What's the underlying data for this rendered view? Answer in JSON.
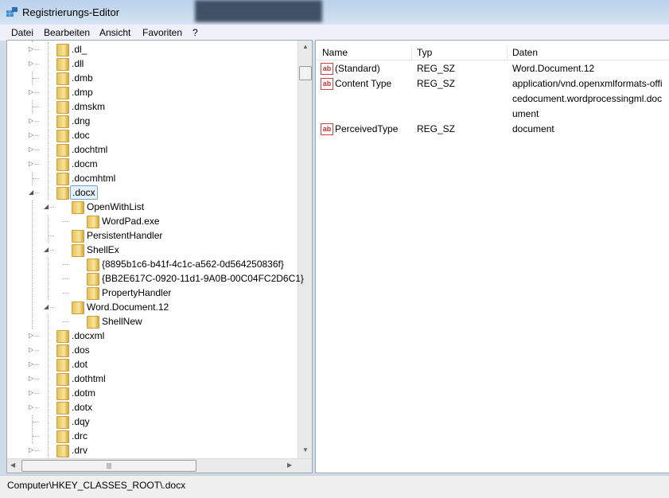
{
  "window": {
    "title": "Registrierungs-Editor"
  },
  "menu": [
    "Datei",
    "Bearbeiten",
    "Ansicht",
    "Favoriten",
    "?"
  ],
  "tree": [
    {
      "label": ".dl_",
      "level": 0,
      "expander": "collapsed"
    },
    {
      "label": ".dll",
      "level": 0,
      "expander": "collapsed"
    },
    {
      "label": ".dmb",
      "level": 0,
      "expander": "none"
    },
    {
      "label": ".dmp",
      "level": 0,
      "expander": "collapsed"
    },
    {
      "label": ".dmskm",
      "level": 0,
      "expander": "none"
    },
    {
      "label": ".dng",
      "level": 0,
      "expander": "collapsed"
    },
    {
      "label": ".doc",
      "level": 0,
      "expander": "collapsed"
    },
    {
      "label": ".dochtml",
      "level": 0,
      "expander": "collapsed"
    },
    {
      "label": ".docm",
      "level": 0,
      "expander": "collapsed"
    },
    {
      "label": ".docmhtml",
      "level": 0,
      "expander": "none"
    },
    {
      "label": ".docx",
      "level": 0,
      "expander": "expanded",
      "selected": true
    },
    {
      "label": "OpenWithList",
      "level": 1,
      "expander": "expanded"
    },
    {
      "label": "WordPad.exe",
      "level": 2,
      "expander": "none"
    },
    {
      "label": "PersistentHandler",
      "level": 1,
      "expander": "none"
    },
    {
      "label": "ShellEx",
      "level": 1,
      "expander": "expanded"
    },
    {
      "label": "{8895b1c6-b41f-4c1c-a562-0d564250836f}",
      "level": 2,
      "expander": "none"
    },
    {
      "label": "{BB2E617C-0920-11d1-9A0B-00C04FC2D6C1}",
      "level": 2,
      "expander": "none"
    },
    {
      "label": "PropertyHandler",
      "level": 2,
      "expander": "none"
    },
    {
      "label": "Word.Document.12",
      "level": 1,
      "expander": "expanded"
    },
    {
      "label": "ShellNew",
      "level": 2,
      "expander": "none"
    },
    {
      "label": ".docxml",
      "level": 0,
      "expander": "collapsed"
    },
    {
      "label": ".dos",
      "level": 0,
      "expander": "collapsed"
    },
    {
      "label": ".dot",
      "level": 0,
      "expander": "collapsed"
    },
    {
      "label": ".dothtml",
      "level": 0,
      "expander": "collapsed"
    },
    {
      "label": ".dotm",
      "level": 0,
      "expander": "collapsed"
    },
    {
      "label": ".dotx",
      "level": 0,
      "expander": "collapsed"
    },
    {
      "label": ".dqy",
      "level": 0,
      "expander": "none"
    },
    {
      "label": ".drc",
      "level": 0,
      "expander": "none"
    },
    {
      "label": ".drv",
      "level": 0,
      "expander": "collapsed"
    }
  ],
  "list": {
    "columns": [
      "Name",
      "Typ",
      "Daten"
    ],
    "rows": [
      {
        "name": "(Standard)",
        "type": "REG_SZ",
        "data": "Word.Document.12",
        "icon": "ab"
      },
      {
        "name": "Content Type",
        "type": "REG_SZ",
        "data": "application/vnd.openxmlformats-officedocument.wordprocessingml.document",
        "icon": "ab"
      },
      {
        "name": "PerceivedType",
        "type": "REG_SZ",
        "data": "document",
        "icon": "ab"
      }
    ]
  },
  "status": "Computer\\HKEY_CLASSES_ROOT\\.docx"
}
